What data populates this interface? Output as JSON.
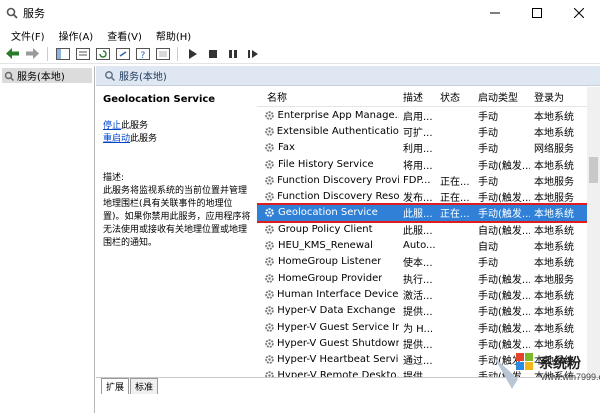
{
  "window": {
    "title": "服务",
    "controls": [
      "minimize",
      "maximize",
      "close"
    ]
  },
  "menu": [
    "文件(F)",
    "操作(A)",
    "查看(V)",
    "帮助(H)"
  ],
  "toolbar": {
    "icons": [
      "back-icon",
      "forward-icon",
      "console-tree-icon",
      "properties-icon",
      "refresh-icon",
      "export-icon",
      "help-icon",
      "properties2-icon",
      "start-icon",
      "stop-icon",
      "pause-icon",
      "restart-icon"
    ]
  },
  "tree": {
    "root": "服务(本地)"
  },
  "panel": {
    "header": "服务(本地)"
  },
  "details": {
    "service_name": "Geolocation Service",
    "stop_link": "停止",
    "stop_suffix": "此服务",
    "restart_link": "重启动",
    "restart_suffix": "此服务",
    "desc_label": "描述:",
    "description": "此服务将监视系统的当前位置并管理地理围栏(具有关联事件的地理位置)。如果你禁用此服务，应用程序将无法使用或接收有关地理位置或地理围栏的通知。"
  },
  "columns": [
    "名称",
    "描述",
    "状态",
    "启动类型",
    "登录为"
  ],
  "rows": [
    {
      "name": "Enterprise App Manage...",
      "desc": "启用...",
      "status": "",
      "startup": "手动",
      "logon": "本地系统"
    },
    {
      "name": "Extensible Authentication...",
      "desc": "可扩...",
      "status": "",
      "startup": "手动",
      "logon": "本地系统"
    },
    {
      "name": "Fax",
      "desc": "利用...",
      "status": "",
      "startup": "手动",
      "logon": "网络服务"
    },
    {
      "name": "File History Service",
      "desc": "将用...",
      "status": "",
      "startup": "手动(触发...",
      "logon": "本地系统"
    },
    {
      "name": "Function Discovery Provi...",
      "desc": "FDP...",
      "status": "正在...",
      "startup": "手动",
      "logon": "本地服务"
    },
    {
      "name": "Function Discovery Reso...",
      "desc": "发布...",
      "status": "正在...",
      "startup": "手动(触发...",
      "logon": "本地服务"
    },
    {
      "name": "Geolocation Service",
      "desc": "此服...",
      "status": "正在...",
      "startup": "手动(触发...",
      "logon": "本地系统",
      "selected": true
    },
    {
      "name": "Group Policy Client",
      "desc": "此服...",
      "status": "",
      "startup": "自动(触发...",
      "logon": "本地系统"
    },
    {
      "name": "HEU_KMS_Renewal",
      "desc": "Auto...",
      "status": "",
      "startup": "自动",
      "logon": "本地系统"
    },
    {
      "name": "HomeGroup Listener",
      "desc": "使本...",
      "status": "",
      "startup": "手动",
      "logon": "本地系统"
    },
    {
      "name": "HomeGroup Provider",
      "desc": "执行...",
      "status": "",
      "startup": "手动(触发...",
      "logon": "本地服务"
    },
    {
      "name": "Human Interface Device ...",
      "desc": "激活...",
      "status": "",
      "startup": "手动(触发...",
      "logon": "本地系统"
    },
    {
      "name": "Hyper-V Data Exchange ...",
      "desc": "提供...",
      "status": "",
      "startup": "手动(触发...",
      "logon": "本地系统"
    },
    {
      "name": "Hyper-V Guest Service In...",
      "desc": "为 H...",
      "status": "",
      "startup": "手动(触发...",
      "logon": "本地系统"
    },
    {
      "name": "Hyper-V Guest Shutdown...",
      "desc": "提供...",
      "status": "",
      "startup": "手动(触发...",
      "logon": "本地系统"
    },
    {
      "name": "Hyper-V Heartbeat Service",
      "desc": "通过...",
      "status": "",
      "startup": "手动(触发...",
      "logon": "本地系统"
    },
    {
      "name": "Hyper-V Remote Deskto...",
      "desc": "提供...",
      "status": "",
      "startup": "手动(触发...",
      "logon": "本地系统"
    }
  ],
  "tabs": [
    "扩展",
    "标准"
  ],
  "watermark": {
    "brand": "系统粉",
    "url": "www.win7999.com"
  }
}
